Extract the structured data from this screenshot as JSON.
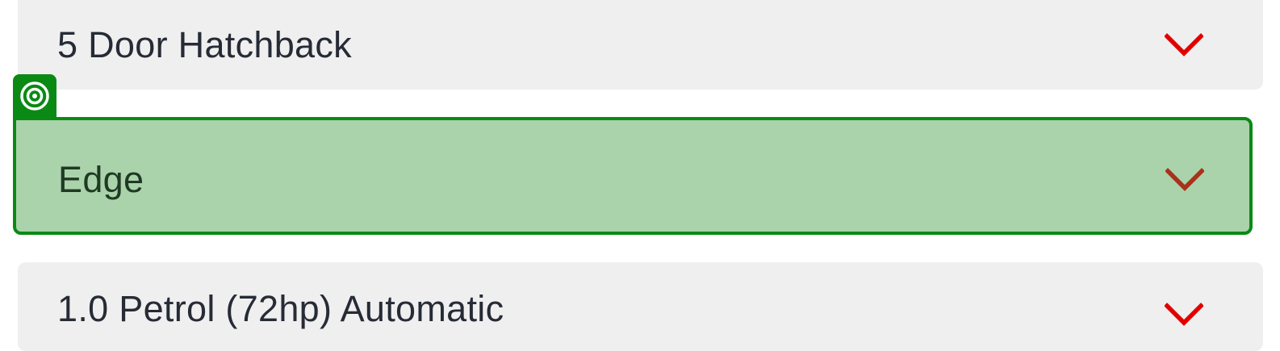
{
  "dropdowns": {
    "body_type": {
      "selected": "5 Door Hatchback",
      "icon": "chevron-down-icon",
      "chevron_color": "#e00000"
    },
    "trim": {
      "selected": "Edge",
      "icon": "chevron-down-icon",
      "chevron_color": "#a8321a",
      "focused": true,
      "focus_icon": "target-icon",
      "focus_color": "#0a8a14",
      "highlight_bg": "#aad3ab"
    },
    "engine": {
      "selected": "1.0 Petrol (72hp) Automatic",
      "icon": "chevron-down-icon",
      "chevron_color": "#e00000"
    }
  },
  "colors": {
    "field_bg": "#efefef",
    "text": "#262b36"
  }
}
